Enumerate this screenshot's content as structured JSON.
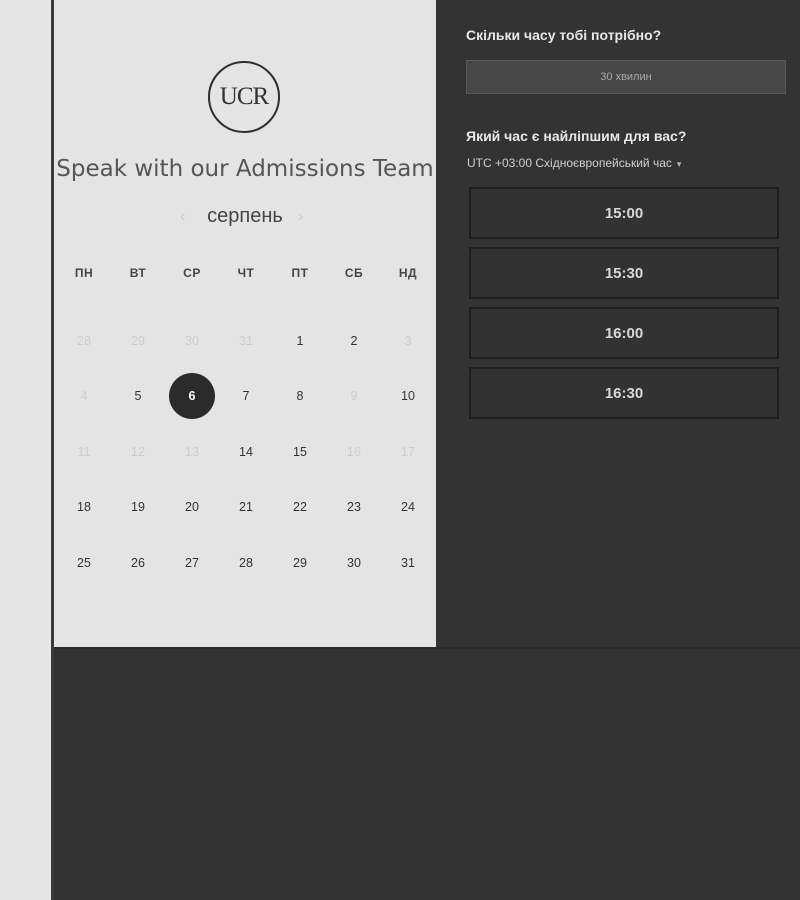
{
  "booking": {
    "logo_text": "UCR",
    "title": "Speak with our Admissions Team",
    "month": "серпень",
    "nav_prev": "‹",
    "nav_next": "›",
    "weekdays": [
      "ПН",
      "ВТ",
      "СР",
      "ЧТ",
      "ПТ",
      "СБ",
      "НД"
    ],
    "days": [
      {
        "label": "28",
        "state": "disabled"
      },
      {
        "label": "29",
        "state": "disabled"
      },
      {
        "label": "30",
        "state": "disabled"
      },
      {
        "label": "31",
        "state": "disabled"
      },
      {
        "label": "1",
        "state": "available"
      },
      {
        "label": "2",
        "state": "available"
      },
      {
        "label": "3",
        "state": "disabled"
      },
      {
        "label": "4",
        "state": "disabled"
      },
      {
        "label": "5",
        "state": "available"
      },
      {
        "label": "6",
        "state": "selected"
      },
      {
        "label": "7",
        "state": "available"
      },
      {
        "label": "8",
        "state": "available"
      },
      {
        "label": "9",
        "state": "disabled"
      },
      {
        "label": "10",
        "state": "available"
      },
      {
        "label": "11",
        "state": "disabled"
      },
      {
        "label": "12",
        "state": "disabled"
      },
      {
        "label": "13",
        "state": "disabled"
      },
      {
        "label": "14",
        "state": "available"
      },
      {
        "label": "15",
        "state": "available"
      },
      {
        "label": "16",
        "state": "disabled"
      },
      {
        "label": "17",
        "state": "disabled"
      },
      {
        "label": "18",
        "state": "available"
      },
      {
        "label": "19",
        "state": "available"
      },
      {
        "label": "20",
        "state": "available"
      },
      {
        "label": "21",
        "state": "available"
      },
      {
        "label": "22",
        "state": "available"
      },
      {
        "label": "23",
        "state": "available"
      },
      {
        "label": "24",
        "state": "available"
      },
      {
        "label": "25",
        "state": "available"
      },
      {
        "label": "26",
        "state": "available"
      },
      {
        "label": "27",
        "state": "available"
      },
      {
        "label": "28",
        "state": "available"
      },
      {
        "label": "29",
        "state": "available"
      },
      {
        "label": "30",
        "state": "available"
      },
      {
        "label": "31",
        "state": "available"
      }
    ],
    "duration_question": "Скільки часу тобі потрібно?",
    "duration_value": "30 хвилин",
    "time_question": "Який час є найліпшим для вас?",
    "timezone": "UTC +03:00 Східноєвропейський час",
    "timezone_caret": "▾",
    "slots": [
      "15:00",
      "15:30",
      "16:00",
      "16:30"
    ]
  }
}
